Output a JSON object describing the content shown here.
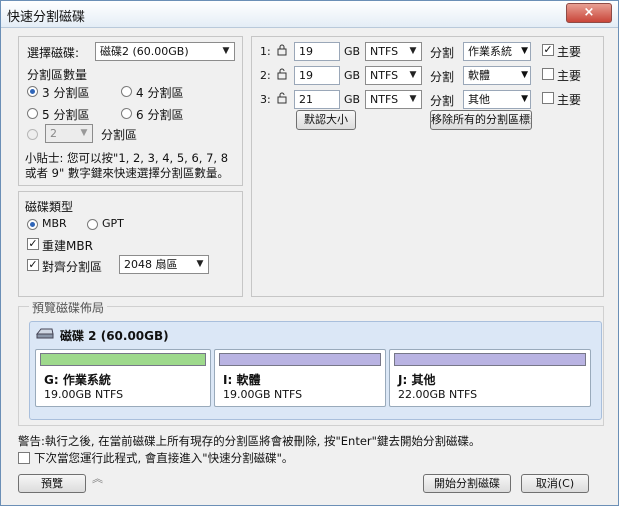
{
  "window": {
    "title": "快速分割磁碟",
    "close_glyph": "×"
  },
  "disk_select": {
    "label": "選擇磁碟:",
    "value": "磁碟2 (60.00GB)"
  },
  "partition_count": {
    "label": "分割區數量",
    "options": [
      {
        "label": "3 分割區",
        "selected": true
      },
      {
        "label": "4 分割區",
        "selected": false
      },
      {
        "label": "5 分割區",
        "selected": false
      },
      {
        "label": "6 分割區",
        "selected": false
      }
    ],
    "custom_value": "2",
    "custom_label": "分割區"
  },
  "tip": "小貼士: 您可以按\"1, 2, 3, 4, 5, 6, 7, 8 或者 9\" 數字鍵來快速選擇分割區數量。",
  "disk_type": {
    "label": "磁碟類型",
    "mbr": "MBR",
    "gpt": "GPT",
    "rebuild_mbr": "重建MBR",
    "align": "對齊分割區",
    "align_value": "2048 扇區"
  },
  "partitions": [
    {
      "index": "1:",
      "size": "19",
      "unit": "GB",
      "fs": "NTFS",
      "label_text": "分割",
      "name": "作業系統",
      "primary": "主要",
      "primary_checked": true,
      "locked": true
    },
    {
      "index": "2:",
      "size": "19",
      "unit": "GB",
      "fs": "NTFS",
      "label_text": "分割",
      "name": "軟體",
      "primary": "主要",
      "primary_checked": false,
      "locked": false
    },
    {
      "index": "3:",
      "size": "21",
      "unit": "GB",
      "fs": "NTFS",
      "label_text": "分割",
      "name": "其他",
      "primary": "主要",
      "primary_checked": false,
      "locked": false
    }
  ],
  "buttons": {
    "default_size": "默認大小",
    "remove_labels": "移除所有的分割區標籤",
    "preview": "預覽",
    "start": "開始分割磁碟",
    "cancel": "取消(C)"
  },
  "preview": {
    "legend": "預覽磁碟佈局",
    "disk_title": "磁碟 2 (60.00GB)",
    "parts": [
      {
        "name": "G: 作業系統",
        "size": "19.00GB NTFS",
        "color": "#9ed98c"
      },
      {
        "name": "I: 軟體",
        "size": "19.00GB NTFS",
        "color": "#b9b3e2"
      },
      {
        "name": "J: 其他",
        "size": "22.00GB NTFS",
        "color": "#b9b3e2"
      }
    ]
  },
  "warning": "警告:執行之後, 在當前磁碟上所有現存的分割區將會被刪除, 按\"Enter\"鍵去開始分割磁碟。",
  "next_time": "下次當您運行此程式, 會直接進入\"快速分割磁碟\"。"
}
